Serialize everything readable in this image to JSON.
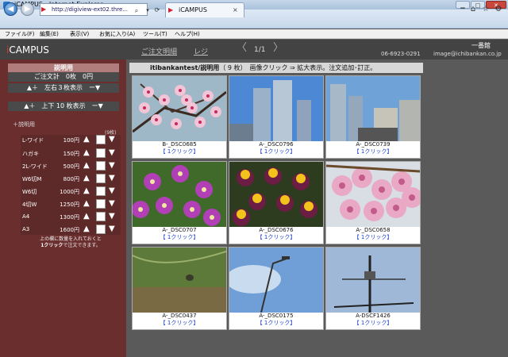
{
  "browser": {
    "title": "iCAMPUS - Internet Explorer",
    "address": "http://digiview-ext02.thre...",
    "tab_title": "iCAMPUS",
    "menu": [
      "ファイル(F)",
      "編集(E)",
      "表示(V)",
      "お気に入り(A)",
      "ツール(T)",
      "ヘルプ(H)"
    ]
  },
  "header": {
    "logo_i": "i",
    "logo_rest": "CAMPUS",
    "order_link": "ご注文明細",
    "register_link": "レジ",
    "page_count": "1/1",
    "shop_name": "一番館",
    "phone": "06-6923-0291",
    "email": "image@ichibankan.co.jp"
  },
  "sidebar": {
    "title": "説明用",
    "order_total": "ご注文計　0枚　0円",
    "horizontal_control": "▲＋　左右３枚表示　ー▼",
    "vertical_control": "▲＋　上下 10 枚表示　ー▼",
    "description_label": "＋説明用",
    "unit_label": "(9枚)",
    "prices": [
      {
        "size": "L-ワイド",
        "price": "100円"
      },
      {
        "size": "ハガキ",
        "price": "150円"
      },
      {
        "size": "2L-ワイド",
        "price": "500円"
      },
      {
        "size": "W6切M",
        "price": "800円"
      },
      {
        "size": "W6切",
        "price": "1000円"
      },
      {
        "size": "4切W",
        "price": "1250円"
      },
      {
        "size": "A4",
        "price": "1300円"
      },
      {
        "size": "A3",
        "price": "1600円"
      }
    ],
    "note_line1": "上の欄に数量を入れておくと",
    "note_bold": "1クリック",
    "note_line2": "で注文できます。"
  },
  "main": {
    "album": "itibankantest/",
    "album_title": "説明用",
    "album_count": "（ 9 枚）",
    "instruction": "画像クリック ⇒ 拡大表示。注文追加･訂正。",
    "photos": [
      {
        "name": "B-_DSC0685",
        "click": "【 1クリック】",
        "kind": "blossom"
      },
      {
        "name": "A-_DSC0796",
        "click": "【 1クリック】",
        "kind": "towers"
      },
      {
        "name": "A-_DSC0739",
        "click": "【 1クリック】",
        "kind": "city"
      },
      {
        "name": "A-_DSC0707",
        "click": "【 1クリック】",
        "kind": "purple-flowers"
      },
      {
        "name": "A-_DSC0676",
        "click": "【 1クリック】",
        "kind": "pansies"
      },
      {
        "name": "A-_DSC0658",
        "click": "【 1クリック】",
        "kind": "pink-blossom"
      },
      {
        "name": "A-_DSC0437",
        "click": "【 1クリック】",
        "kind": "grass"
      },
      {
        "name": "A-_DSC0175",
        "click": "【 1クリック】",
        "kind": "sky-lamp"
      },
      {
        "name": "A-DSCF1426",
        "click": "【 1クリック】",
        "kind": "crane"
      }
    ]
  }
}
